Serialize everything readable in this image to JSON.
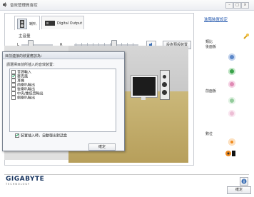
{
  "window": {
    "title": "音效管理員會控",
    "controls": [
      "–",
      "□",
      "×"
    ]
  },
  "tabs": [
    {
      "label": "喇叭"
    },
    {
      "label": "Digital Output"
    }
  ],
  "volume": {
    "label": "主音量",
    "left": "L",
    "right": "R",
    "set_default": "設為預設裝置"
  },
  "dialog": {
    "title": "目前連接的裝置應該為：",
    "prompt": "請選擇目前所插入的音效裝置：",
    "items": [
      {
        "label": "音源輸入",
        "checked": false
      },
      {
        "label": "麥克風",
        "checked": true
      },
      {
        "label": "耳機",
        "checked": false
      },
      {
        "label": "前喇叭輸出",
        "checked": false
      },
      {
        "label": "後喇叭輸出",
        "checked": false
      },
      {
        "label": "中央/重低音輸出",
        "checked": false
      },
      {
        "label": "側喇叭輸出",
        "checked": false
      }
    ],
    "auto_popup": "裝置插入時，自動彈出對話盒",
    "auto_popup_checked": true,
    "ok": "確定"
  },
  "right": {
    "link": "進階裝置設定",
    "analog": "類比",
    "back_panel": "後面板",
    "front_panel": "前面板",
    "digital": "數位"
  },
  "brand": {
    "name": "GIGABYTE",
    "sub": "TECHNOLOGY"
  },
  "footer": {
    "ok": "確定"
  },
  "colors": {
    "jack_blue": "#5b87c9",
    "jack_green": "#3aa24a",
    "jack_pink": "#e08ab4",
    "jack_orange": "#f08a1e"
  }
}
